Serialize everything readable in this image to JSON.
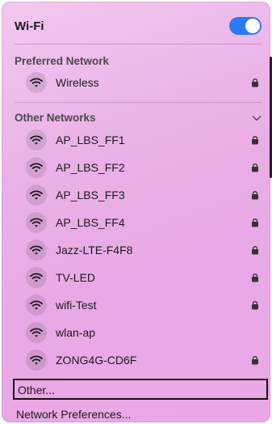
{
  "header": {
    "title": "Wi-Fi",
    "wifi_enabled": true
  },
  "preferred": {
    "title": "Preferred Network",
    "network": {
      "name": "Wireless",
      "locked": true
    }
  },
  "others": {
    "title": "Other Networks",
    "networks": [
      {
        "name": "AP_LBS_FF1",
        "locked": true
      },
      {
        "name": "AP_LBS_FF2",
        "locked": true
      },
      {
        "name": "AP_LBS_FF3",
        "locked": true
      },
      {
        "name": "AP_LBS_FF4",
        "locked": true
      },
      {
        "name": "Jazz-LTE-F4F8",
        "locked": true
      },
      {
        "name": "TV-LED",
        "locked": true
      },
      {
        "name": "wifi-Test",
        "locked": true
      },
      {
        "name": "wlan-ap",
        "locked": false
      },
      {
        "name": "ZONG4G-CD6F",
        "locked": true
      }
    ]
  },
  "footer": {
    "other_label": "Other...",
    "preferences_label": "Network Preferences..."
  },
  "colors": {
    "toggle": "#2a7bf6",
    "panel_top": "#f3c7ef",
    "panel_bottom": "#eaa7e6"
  }
}
